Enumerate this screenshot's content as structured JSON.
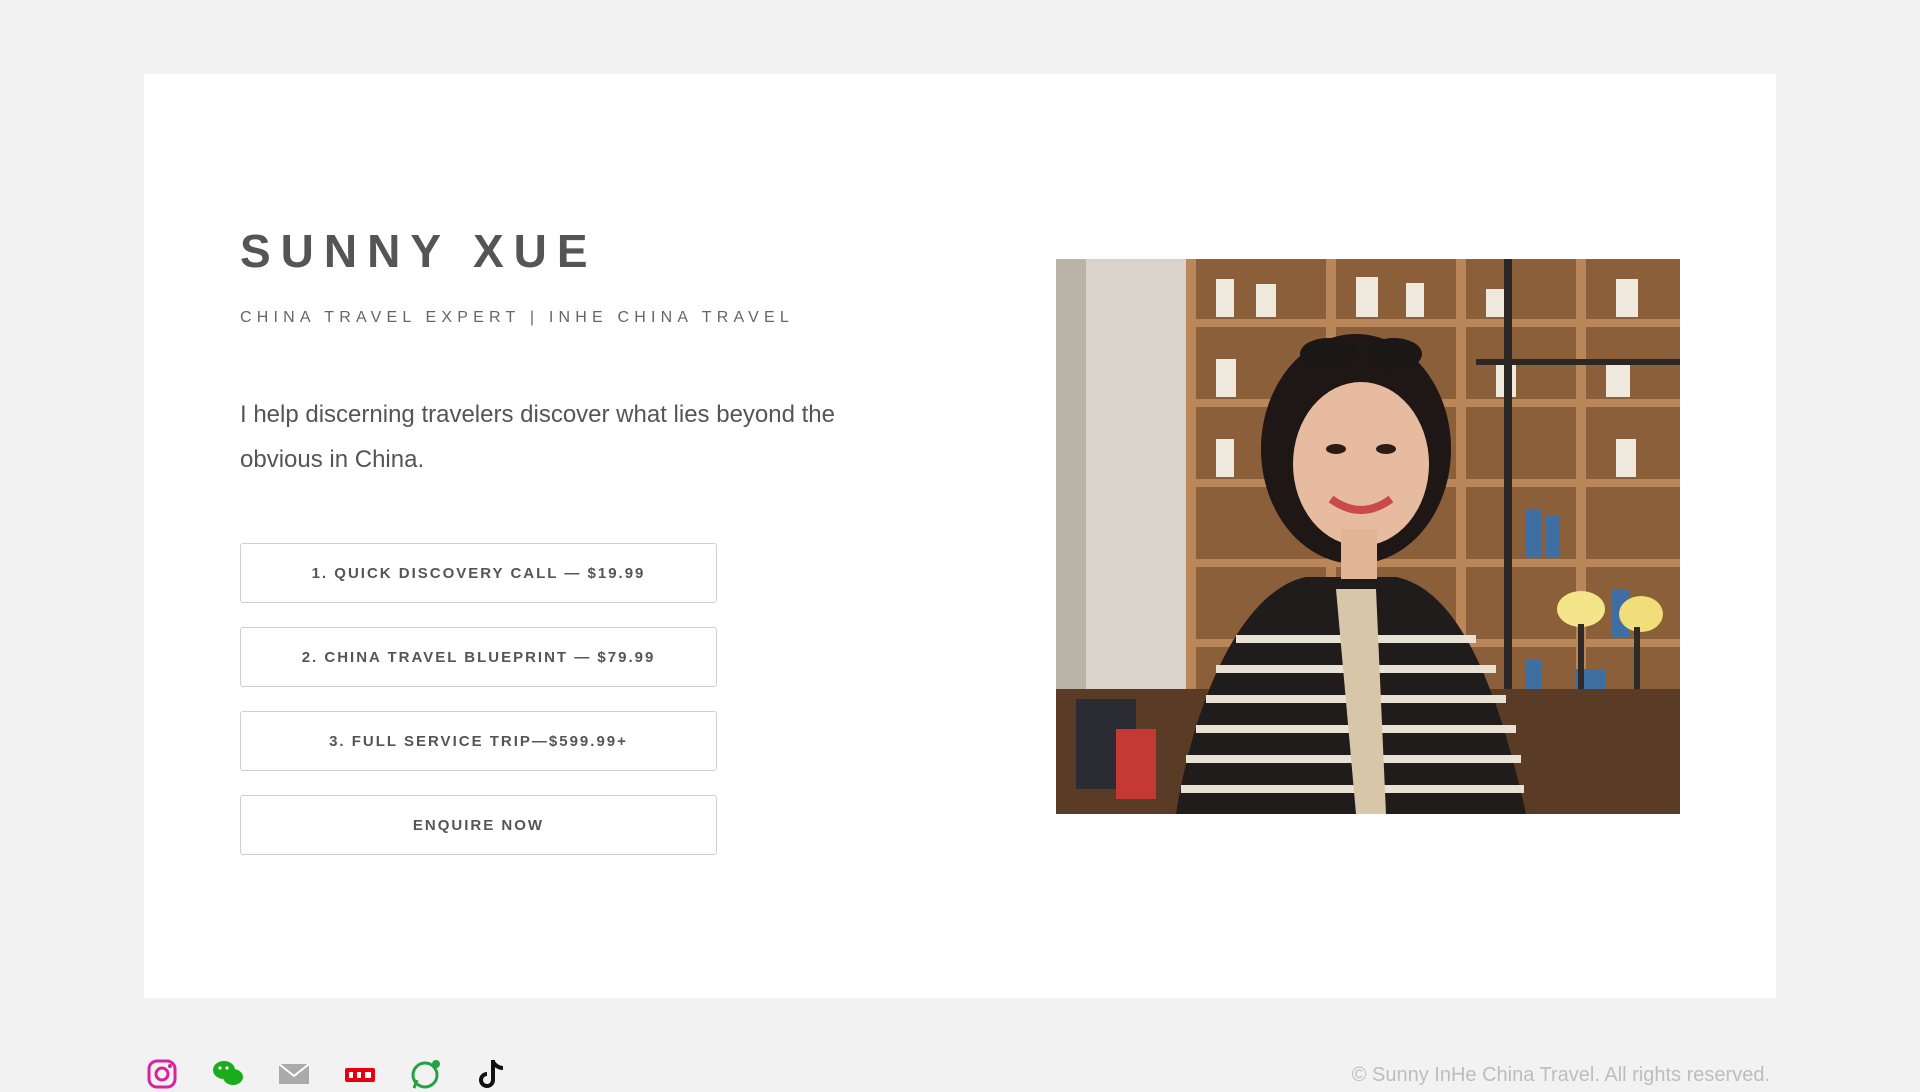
{
  "hero": {
    "name": "SUNNY XUE",
    "tagline": "CHINA TRAVEL EXPERT | INHE CHINA TRAVEL",
    "intro": "I help discerning travelers discover what lies beyond the obvious in China."
  },
  "buttons": {
    "quick_call": "1. QUICK DISCOVERY CALL — $19.99",
    "blueprint": "2. CHINA TRAVEL BLUEPRINT — $79.99",
    "full_service": "3. FULL SERVICE TRIP—$599.99+",
    "enquire": "ENQUIRE NOW"
  },
  "footer": {
    "copyright": "© Sunny InHe China Travel. All rights reserved.",
    "icons": [
      "instagram-icon",
      "wechat-icon",
      "email-icon",
      "xiaohongshu-icon",
      "whatsapp-icon",
      "tiktok-icon"
    ]
  },
  "colors": {
    "background": "#f2f2f2",
    "card": "#ffffff",
    "text": "#555555",
    "instagram": "#e1306c",
    "wechat": "#1aad19",
    "xiaohongshu": "#e60012",
    "whatsapp": "#25a244"
  }
}
